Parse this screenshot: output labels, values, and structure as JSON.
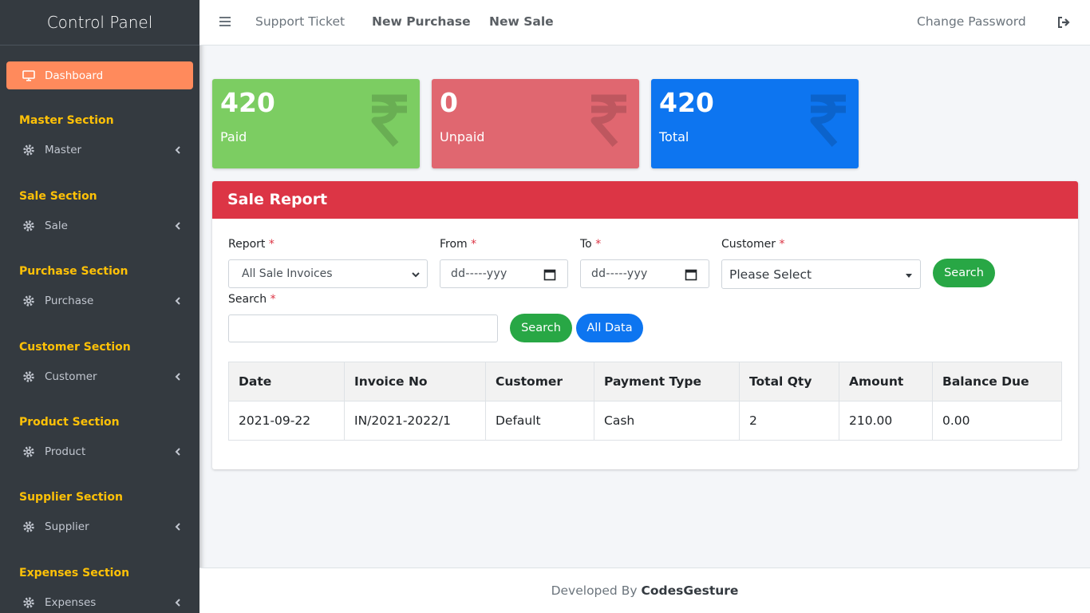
{
  "sidebar": {
    "brand": "Control Panel",
    "dashboard_label": "Dashboard",
    "sections": [
      {
        "title": "Master Section",
        "item": "Master"
      },
      {
        "title": "Sale Section",
        "item": "Sale"
      },
      {
        "title": "Purchase Section",
        "item": "Purchase"
      },
      {
        "title": "Customer Section",
        "item": "Customer"
      },
      {
        "title": "Product Section",
        "item": "Product"
      },
      {
        "title": "Supplier Section",
        "item": "Supplier"
      },
      {
        "title": "Expenses Section",
        "item": "Expenses"
      }
    ]
  },
  "topnav": {
    "support_ticket": "Support Ticket",
    "new_purchase": "New Purchase",
    "new_sale": "New Sale",
    "change_password": "Change Password"
  },
  "stats": [
    {
      "value": "420",
      "label": "Paid",
      "color": "#7ccd62"
    },
    {
      "value": "0",
      "label": "Unpaid",
      "color": "#e06770"
    },
    {
      "value": "420",
      "label": "Total",
      "color": "#0d75f0"
    }
  ],
  "report": {
    "title": "Sale Report",
    "report_label": "Report",
    "report_value": "All Sale Invoices",
    "from_label": "From",
    "from_value": "dd-----yyy",
    "to_label": "To",
    "to_value": "dd-----yyy",
    "customer_label": "Customer",
    "customer_value": "Please Select",
    "search_button": "Search",
    "search_label": "Search",
    "search_value": "",
    "search_button2": "Search",
    "all_data_button": "All Data",
    "required_mark": "*"
  },
  "table": {
    "headers": [
      "Date",
      "Invoice No",
      "Customer",
      "Payment Type",
      "Total Qty",
      "Amount",
      "Balance Due"
    ],
    "rows": [
      [
        "2021-09-22",
        "IN/2021-2022/1",
        "Default",
        "Cash",
        "2",
        "210.00",
        "0.00"
      ]
    ]
  },
  "footer": {
    "prefix": "Developed By",
    "brand": "CodesGesture"
  },
  "colors": {
    "sidebar_bg": "#343a40",
    "accent_orange": "#ff8a5c",
    "section_yellow": "#ffc107",
    "header_red": "#dc3545",
    "button_green": "#28a745",
    "button_blue": "#0d75f0"
  }
}
